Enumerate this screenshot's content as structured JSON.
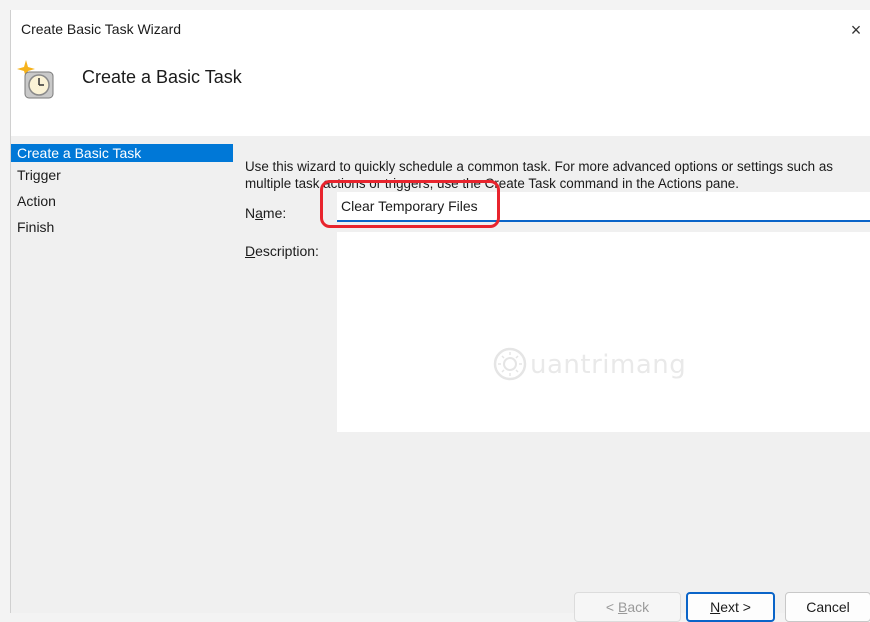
{
  "window": {
    "title": "Create Basic Task Wizard",
    "close_glyph": "×"
  },
  "header": {
    "title": "Create a Basic Task",
    "icon": "clock-task-icon"
  },
  "steps": [
    {
      "label": "Create a Basic Task",
      "active": true
    },
    {
      "label": "Trigger",
      "active": false
    },
    {
      "label": "Action",
      "active": false
    },
    {
      "label": "Finish",
      "active": false
    }
  ],
  "content": {
    "intro": "Use this wizard to quickly schedule a common task.  For more advanced options or settings such as multiple task actions or triggers, use the Create Task command in the Actions pane.",
    "name_label_pre": "N",
    "name_label_acc": "a",
    "name_label_post": "me:",
    "name_value": "Clear Temporary Files",
    "desc_label_acc": "D",
    "desc_label_post": "escription:",
    "desc_value": ""
  },
  "watermark": {
    "text": "uantrimang"
  },
  "buttons": {
    "back_pre": "< ",
    "back_acc": "B",
    "back_post": "ack",
    "next_acc": "N",
    "next_post": "ext >",
    "cancel": "Cancel"
  },
  "colors": {
    "accent": "#0078d7",
    "highlight": "#e8242d"
  }
}
